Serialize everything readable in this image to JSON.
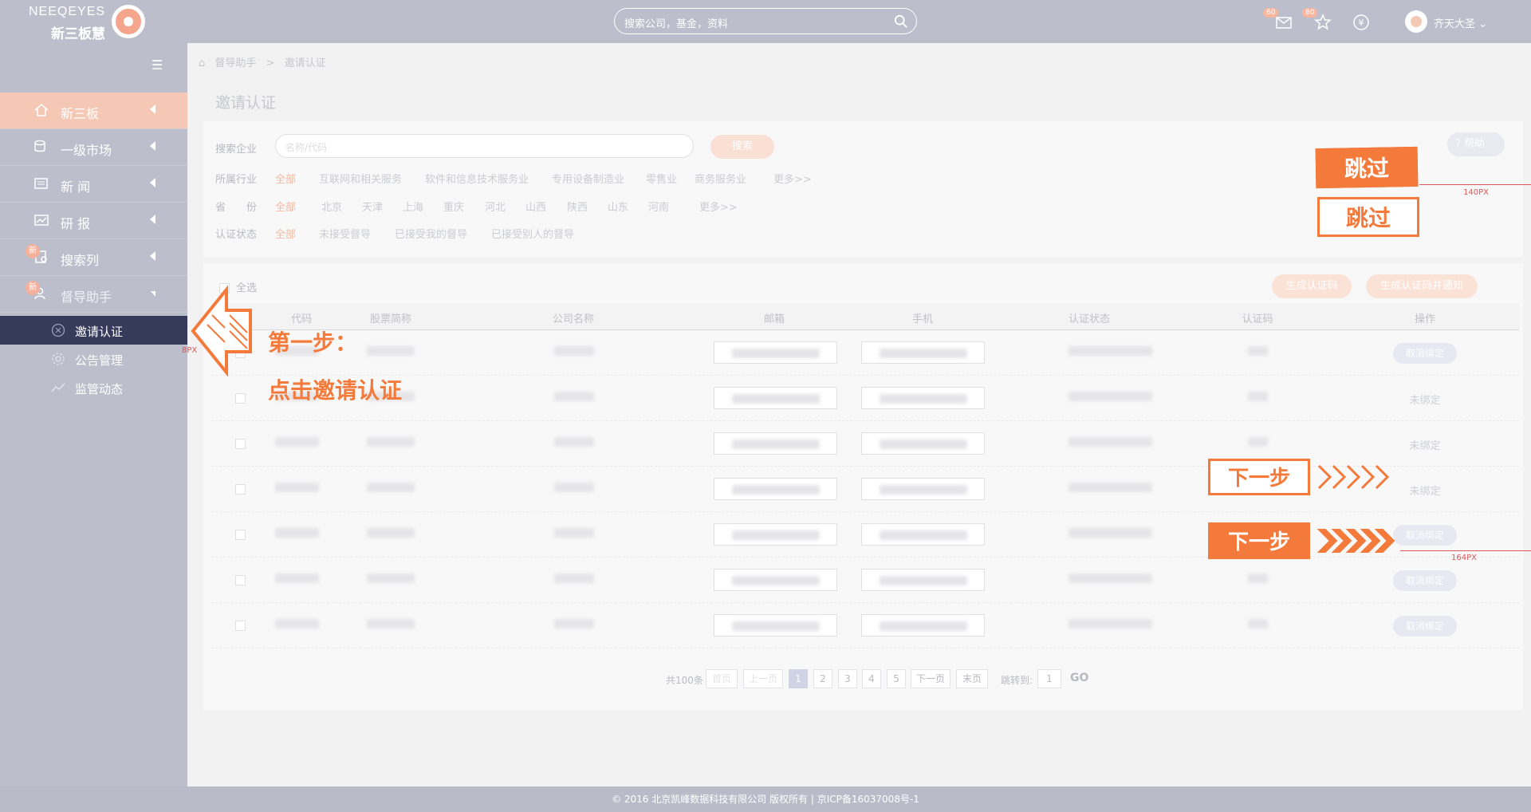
{
  "header": {
    "logo_text_top": "NEEQEYES",
    "logo_text_bottom": "新三板慧",
    "search_placeholder": "搜索公司，基金，资料",
    "mail_badge": "60",
    "star_badge": "80",
    "user_name": "齐天大圣"
  },
  "sidebar": {
    "items": [
      {
        "label": "新三板",
        "icon": "home-icon",
        "new": false
      },
      {
        "label": "一级市场",
        "icon": "coins-icon",
        "new": false
      },
      {
        "label": "新 闻",
        "icon": "news-icon",
        "new": false
      },
      {
        "label": "研 报",
        "icon": "report-icon",
        "new": false
      },
      {
        "label": "搜索列",
        "icon": "search-list-icon",
        "new": true
      },
      {
        "label": "督导助手",
        "icon": "assistant-icon",
        "new": true
      }
    ],
    "new_badge": "新",
    "subitems": [
      {
        "label": "邀请认证",
        "icon": "invite-icon"
      },
      {
        "label": "公告管理",
        "icon": "gear-icon"
      },
      {
        "label": "监管动态",
        "icon": "trend-icon"
      }
    ]
  },
  "breadcrumb": {
    "parent": "督导助手",
    "sep": ">",
    "current": "邀请认证"
  },
  "page_title": "邀请认证",
  "filter": {
    "search_label": "搜索企业",
    "search_placeholder": "名称/代码",
    "search_button": "搜索",
    "help_button": "帮助",
    "industry_label": "所属行业",
    "industry_options": [
      "全部",
      "互联网和相关服务",
      "软件和信息技术服务业",
      "专用设备制造业",
      "零售业",
      "商务服务业",
      "更多>>"
    ],
    "province_label": "省　　份",
    "province_options": [
      "全部",
      "北京",
      "天津",
      "上海",
      "重庆",
      "河北",
      "山西",
      "陕西",
      "山东",
      "河南",
      "更多>>"
    ],
    "status_label": "认证状态",
    "status_options": [
      "全部",
      "未接受督导",
      "已接受我的督导",
      "已接受别人的督导"
    ]
  },
  "table": {
    "select_all": "全选",
    "btn_generate": "生成认证码",
    "btn_generate_notify": "生成认证码并通知",
    "headers": [
      "代码",
      "股票简称",
      "公司名称",
      "邮箱",
      "手机",
      "认证状态",
      "认证码",
      "操作"
    ],
    "rows": [
      {
        "op": "取消绑定",
        "op_type": "button"
      },
      {
        "op": "未绑定",
        "op_type": "text"
      },
      {
        "op": "未绑定",
        "op_type": "text"
      },
      {
        "op": "未绑定",
        "op_type": "text"
      },
      {
        "op": "取消绑定",
        "op_type": "button"
      },
      {
        "op": "取消绑定",
        "op_type": "button"
      },
      {
        "op": "取消绑定",
        "op_type": "button"
      }
    ]
  },
  "pager": {
    "total": "共100条",
    "first": "首页",
    "prev": "上一页",
    "pages": [
      "1",
      "2",
      "3",
      "4",
      "5"
    ],
    "next": "下一页",
    "last": "末页",
    "jump_label": "跳转到:",
    "jump_value": "1",
    "go": "GO"
  },
  "footer": "© 2016 北京凯峰数据科技有限公司 版权所有 | 京ICP备16037008号-1",
  "guide": {
    "skip_label": "跳过",
    "next_label": "下一步",
    "step_line1": "第一步：",
    "step_line2": "点击邀请认证",
    "dim_140": "140PX",
    "dim_164": "164PX",
    "dim_8": "8PX",
    "accent": "#f47a3b"
  }
}
